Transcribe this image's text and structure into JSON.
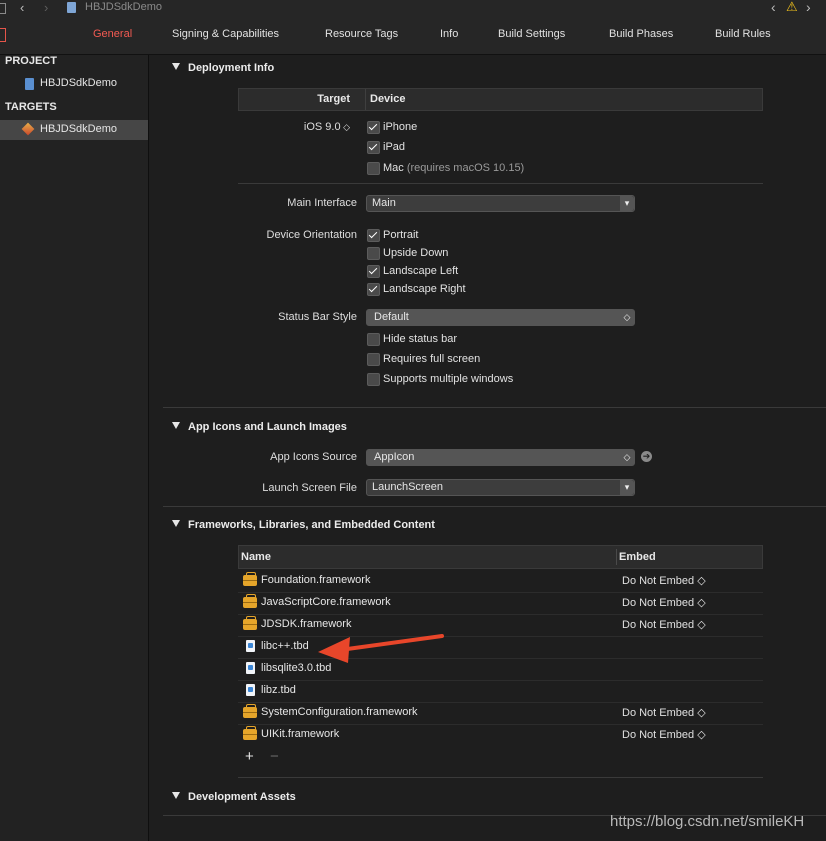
{
  "toolbar": {
    "project_name": "HBJDSdkDemo",
    "warning_symbol": "⚠"
  },
  "tabs": [
    {
      "label": "General",
      "active": true
    },
    {
      "label": "Signing & Capabilities"
    },
    {
      "label": "Resource Tags"
    },
    {
      "label": "Info"
    },
    {
      "label": "Build Settings"
    },
    {
      "label": "Build Phases"
    },
    {
      "label": "Build Rules"
    }
  ],
  "sidebar": {
    "project_header": "PROJECT",
    "project_item": "HBJDSdkDemo",
    "targets_header": "TARGETS",
    "target_item": "HBJDSdkDemo"
  },
  "deployment": {
    "title": "Deployment Info",
    "col_target": "Target",
    "col_device": "Device",
    "ios_version": "iOS 9.0",
    "devices": [
      {
        "label": "iPhone",
        "checked": true
      },
      {
        "label": "iPad",
        "checked": true
      },
      {
        "label": "Mac",
        "note": "(requires macOS 10.15)",
        "checked": false
      }
    ],
    "main_interface_label": "Main Interface",
    "main_interface_value": "Main",
    "orientation_label": "Device Orientation",
    "orientations": [
      {
        "label": "Portrait",
        "checked": true
      },
      {
        "label": "Upside Down",
        "checked": false
      },
      {
        "label": "Landscape Left",
        "checked": true
      },
      {
        "label": "Landscape Right",
        "checked": true
      }
    ],
    "status_bar_label": "Status Bar Style",
    "status_bar_value": "Default",
    "status_options": [
      {
        "label": "Hide status bar",
        "checked": false
      },
      {
        "label": "Requires full screen",
        "checked": false
      },
      {
        "label": "Supports multiple windows",
        "checked": false
      }
    ]
  },
  "app_icons": {
    "title": "App Icons and Launch Images",
    "source_label": "App Icons Source",
    "source_value": "AppIcon",
    "launch_label": "Launch Screen File",
    "launch_value": "LaunchScreen"
  },
  "frameworks": {
    "title": "Frameworks, Libraries, and Embedded Content",
    "col_name": "Name",
    "col_embed": "Embed",
    "items": [
      {
        "name": "Foundation.framework",
        "kind": "framework",
        "embed": "Do Not Embed ◇"
      },
      {
        "name": "JavaScriptCore.framework",
        "kind": "framework",
        "embed": "Do Not Embed ◇"
      },
      {
        "name": "JDSDK.framework",
        "kind": "framework",
        "embed": "Do Not Embed ◇"
      },
      {
        "name": "libc++.tbd",
        "kind": "tbd",
        "embed": ""
      },
      {
        "name": "libsqlite3.0.tbd",
        "kind": "tbd",
        "embed": ""
      },
      {
        "name": "libz.tbd",
        "kind": "tbd",
        "embed": ""
      },
      {
        "name": "SystemConfiguration.framework",
        "kind": "framework",
        "embed": "Do Not Embed ◇"
      },
      {
        "name": "UIKit.framework",
        "kind": "framework",
        "embed": "Do Not Embed ◇"
      }
    ],
    "add_symbol": "+",
    "remove_symbol": "−"
  },
  "dev_assets": {
    "title": "Development Assets"
  },
  "watermark": "https://blog.csdn.net/smileKH",
  "colors": {
    "accent": "#f25a52",
    "arrow": "#e8462a",
    "framework_icon": "#e5a52a"
  }
}
